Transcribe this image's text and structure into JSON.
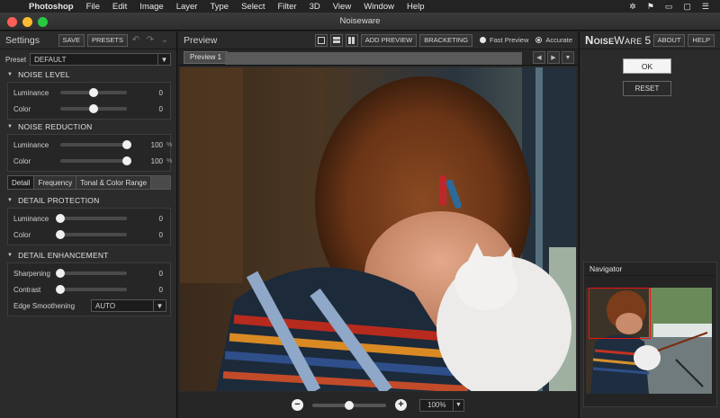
{
  "menubar": {
    "app": "Photoshop",
    "items": [
      "File",
      "Edit",
      "Image",
      "Layer",
      "Type",
      "Select",
      "Filter",
      "3D",
      "View",
      "Window",
      "Help"
    ]
  },
  "window": {
    "title": "Noiseware"
  },
  "settings": {
    "title": "Settings",
    "save_label": "SAVE",
    "presets_label": "PRESETS",
    "preset_label": "Preset",
    "preset_value": "DEFAULT",
    "noise_level": {
      "title": "NOISE LEVEL",
      "rows": [
        {
          "label": "Luminance",
          "value": "0",
          "pos": 0.5
        },
        {
          "label": "Color",
          "value": "0",
          "pos": 0.5
        }
      ]
    },
    "noise_reduction": {
      "title": "NOISE REDUCTION",
      "rows": [
        {
          "label": "Luminance",
          "value": "100",
          "unit": "%",
          "pos": 1.0
        },
        {
          "label": "Color",
          "value": "100",
          "unit": "%",
          "pos": 1.0
        }
      ]
    },
    "tabs": [
      "Detail",
      "Frequency",
      "Tonal & Color Range"
    ],
    "detail_protection": {
      "title": "DETAIL PROTECTION",
      "rows": [
        {
          "label": "Luminance",
          "value": "0",
          "pos": 0.0
        },
        {
          "label": "Color",
          "value": "0",
          "pos": 0.0
        }
      ]
    },
    "detail_enhancement": {
      "title": "DETAIL ENHANCEMENT",
      "rows": [
        {
          "label": "Sharpening",
          "value": "0",
          "pos": 0.0
        },
        {
          "label": "Contrast",
          "value": "0",
          "pos": 0.0
        }
      ],
      "edge_label": "Edge Smoothening",
      "edge_value": "AUTO"
    }
  },
  "preview": {
    "title": "Preview",
    "add_preview_label": "ADD PREVIEW",
    "bracketing_label": "BRACKETING",
    "fast_label": "Fast Preview",
    "accurate_label": "Accurate",
    "tab_label": "Preview 1",
    "zoom_value": "100%",
    "zoom_pos": 0.5
  },
  "right": {
    "logo_big": "N",
    "logo_small_1": "OISE",
    "logo_mid": "W",
    "logo_small_2": "ARE",
    "logo_ver": "5",
    "about_label": "ABOUT",
    "help_label": "HELP",
    "ok_label": "OK",
    "reset_label": "RESET",
    "navigator_title": "Navigator"
  },
  "colors": {
    "accent": "#e11111",
    "panel": "#2b2b2b"
  }
}
